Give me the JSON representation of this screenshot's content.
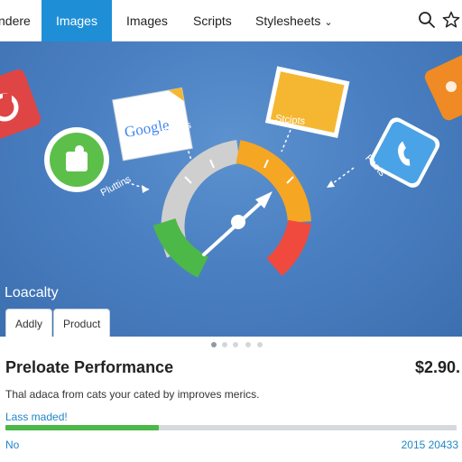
{
  "nav": {
    "tabs": [
      "ndere",
      "Images",
      "Images",
      "Scripts",
      "Stylesheets"
    ],
    "active_index": 1,
    "dropdown_glyph": "⌄",
    "icons": [
      "search-icon",
      "star-icon"
    ]
  },
  "hero": {
    "labels": {
      "google": "Google",
      "images": "Imanes",
      "scripts": "Stcipts",
      "fonts": "Foets",
      "plugins": "Pluttins"
    },
    "title": "Loacalty",
    "chips": [
      "Addly",
      "Product"
    ],
    "gauge_segments": [
      "#cfcfcf",
      "#f5a623",
      "#f04a3f",
      "#4cb847"
    ],
    "tile_colors": {
      "red": "#e04545",
      "green": "#5cbf4a",
      "yellow": "#f5b731",
      "orange": "#f08a24",
      "blue": "#4aa3e6"
    }
  },
  "carousel": {
    "count": 5,
    "active": 0
  },
  "panel": {
    "title": "Preloate Performance",
    "price": "$2.90.",
    "description": "Thal adaca from cats your cated by improves merics.",
    "status": "Lass maded!",
    "progress": 0.34,
    "footer_left": "No",
    "footer_right": "2015 20433"
  },
  "colors": {
    "accent": "#1e8fd6",
    "progress": "#4cb847",
    "link": "#1f86c7"
  }
}
